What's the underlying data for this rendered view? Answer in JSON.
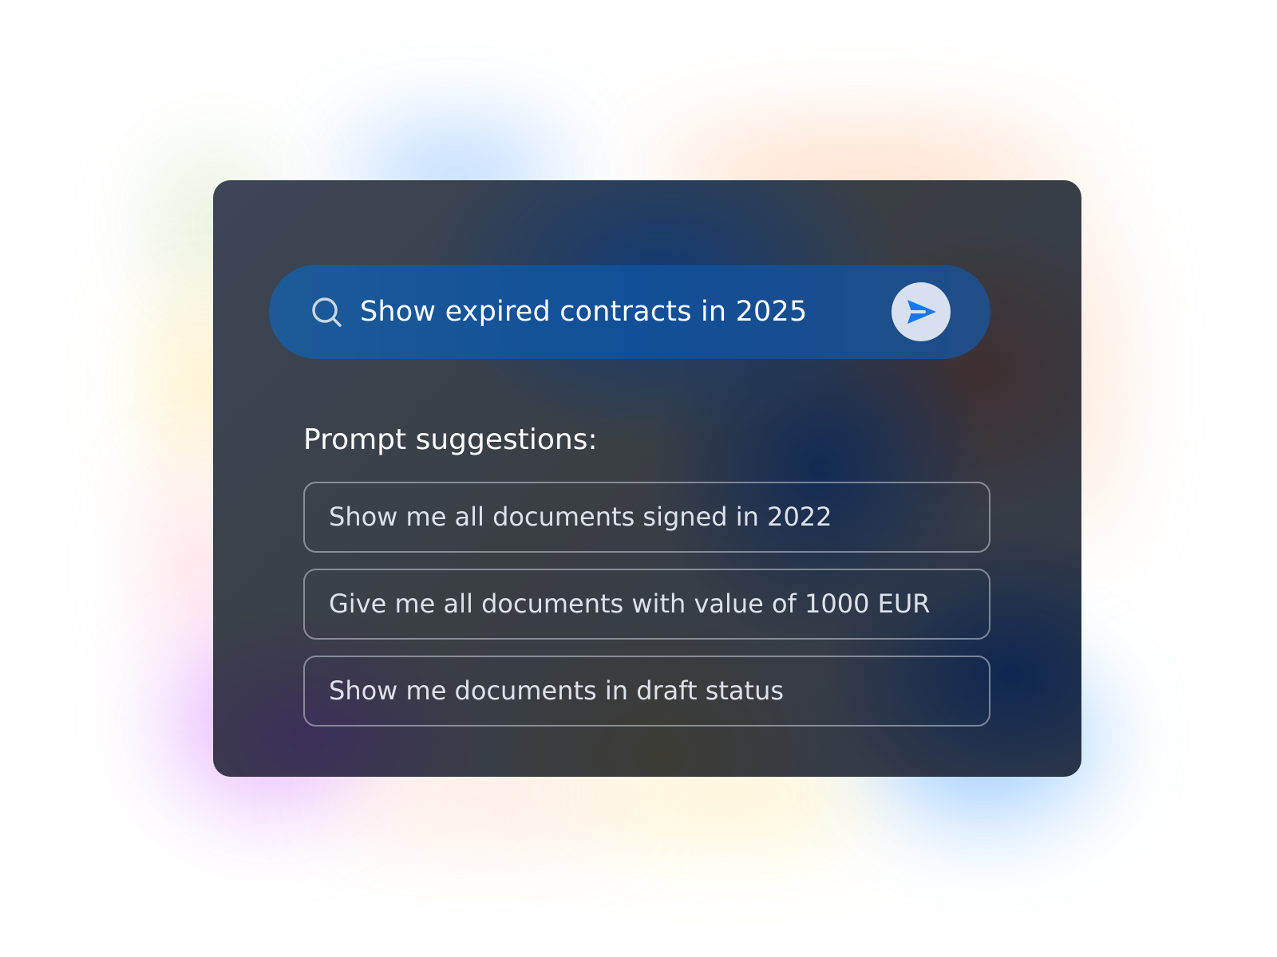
{
  "search": {
    "query": "Show expired contracts in 2025",
    "search_icon": "search-icon",
    "send_icon": "send-icon"
  },
  "suggestions": {
    "heading": "Prompt suggestions:",
    "items": [
      {
        "label": "Show me all documents signed in 2022"
      },
      {
        "label": "Give me all documents with value of 1000 EUR"
      },
      {
        "label": "Show me documents in draft status"
      }
    ]
  },
  "colors": {
    "search_bar": "#114f98",
    "send_button_bg": "#d6e0ee",
    "send_icon": "#1877f2",
    "card_bg": "#3a3f48",
    "text": "#ffffff"
  }
}
